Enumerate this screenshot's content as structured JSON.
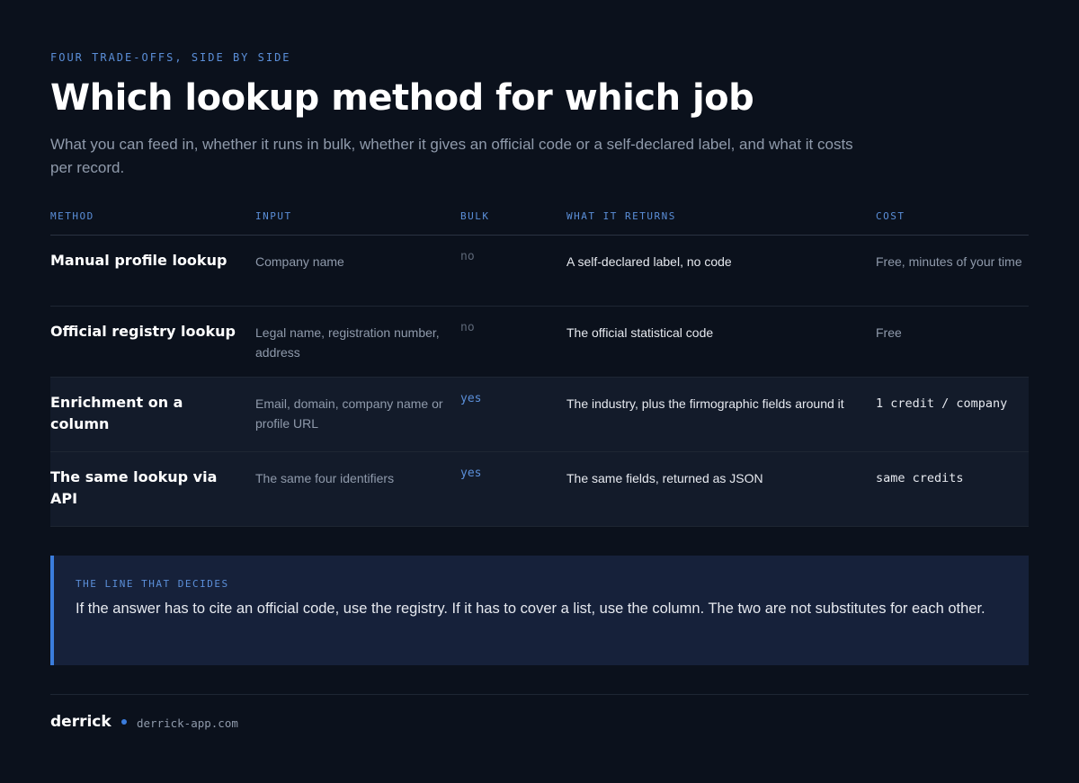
{
  "header": {
    "eyebrow": "FOUR TRADE-OFFS, SIDE BY SIDE",
    "title": "Which lookup method for which job",
    "subtitle": "What you can feed in, whether it runs in bulk, whether it gives an official code or a self-declared label, and what it costs per record."
  },
  "table": {
    "columns": [
      "METHOD",
      "INPUT",
      "BULK",
      "WHAT IT RETURNS",
      "COST"
    ],
    "rows": [
      {
        "method": "Manual profile lookup",
        "input": "Company name",
        "bulk": "no",
        "returns": "A self-declared label, no code",
        "cost": "Free, minutes of your time"
      },
      {
        "method": "Official registry lookup",
        "input": "Legal name, registration number, address",
        "bulk": "no",
        "returns": "The official statistical code",
        "cost": "Free"
      },
      {
        "method": "Enrichment on a column",
        "input": "Email, domain, company name or profile URL",
        "bulk": "yes",
        "returns": "The industry, plus the firmographic fields around it",
        "cost": "1 credit / company"
      },
      {
        "method": "The same lookup via API",
        "input": "The same four identifiers",
        "bulk": "yes",
        "returns": "The same fields, returned as JSON",
        "cost": "same credits"
      }
    ]
  },
  "callout": {
    "label": "THE LINE THAT DECIDES",
    "text": "If the answer has to cite an official code, use the registry. If it has to cover a list, use the column. The two are not substitutes for each other."
  },
  "footer": {
    "brand": "derrick",
    "url": "derrick-app.com"
  },
  "colors": {
    "background": "#0b111c",
    "accent": "#3b7ddd",
    "accent_text": "#5b8fd9",
    "shaded_row": "#131b2a",
    "callout_bg": "#16213a"
  }
}
